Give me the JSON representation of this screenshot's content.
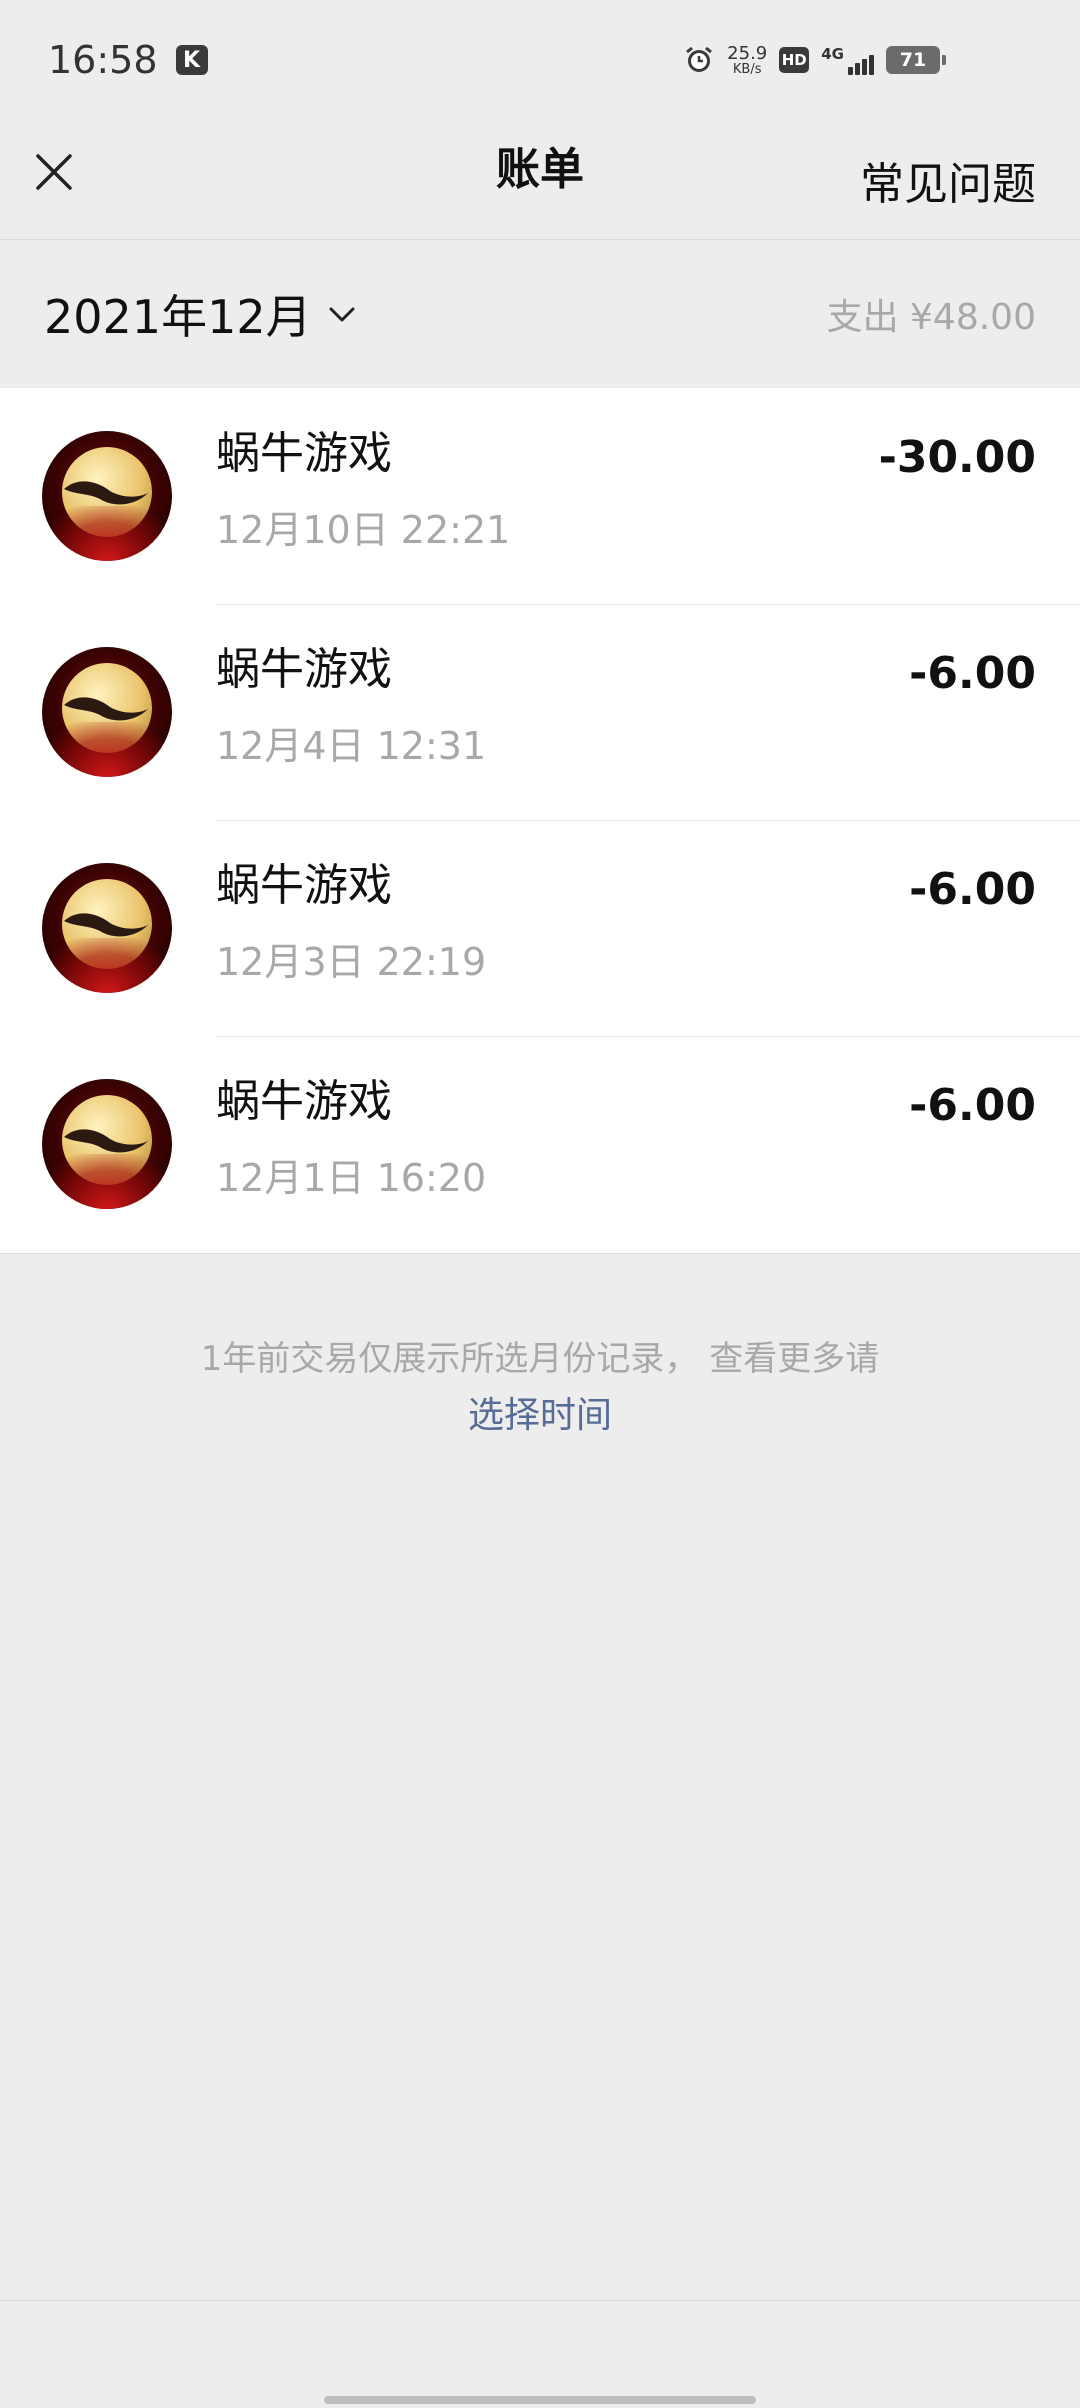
{
  "status_bar": {
    "time": "16:58",
    "app_badge": "K",
    "net_speed_value": "25.9",
    "net_speed_unit": "KB/s",
    "hd_label": "HD",
    "network_label": "4G",
    "battery_level": "71"
  },
  "nav": {
    "title": "账单",
    "faq_label": "常见问题",
    "close_icon": "close-icon"
  },
  "month_header": {
    "month_label": "2021年12月",
    "total_label": "支出 ¥48.00"
  },
  "bills": [
    {
      "merchant": "蜗牛游戏",
      "datetime": "12月10日 22:21",
      "amount": "-30.00"
    },
    {
      "merchant": "蜗牛游戏",
      "datetime": "12月4日 12:31",
      "amount": "-6.00"
    },
    {
      "merchant": "蜗牛游戏",
      "datetime": "12月3日 22:19",
      "amount": "-6.00"
    },
    {
      "merchant": "蜗牛游戏",
      "datetime": "12月1日 16:20",
      "amount": "-6.00"
    }
  ],
  "footnote": {
    "tip": "1年前交易仅展示所选月份记录， 查看更多请",
    "link": "选择时间"
  },
  "colors": {
    "background": "#EDEDED",
    "card": "#FFFFFF",
    "muted_text": "#A8A8A8",
    "link": "#576B95"
  }
}
